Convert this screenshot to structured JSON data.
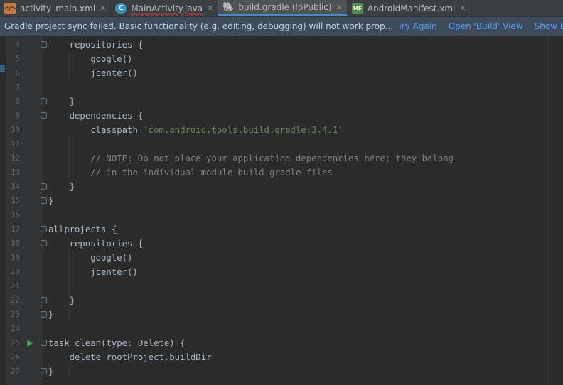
{
  "tabs": [
    {
      "icon": "xml-file-icon",
      "icon_text": "</>",
      "label": "activity_main.xml",
      "active": false,
      "error": false
    },
    {
      "icon": "java-class-icon",
      "icon_text": "C",
      "label": "MainActivity.java",
      "active": false,
      "error": true
    },
    {
      "icon": "gradle-icon",
      "icon_text": "🐘",
      "label": "build.gradle (lpPublic)",
      "active": true,
      "error": false
    },
    {
      "icon": "manifest-icon",
      "icon_text": "MF",
      "label": "AndroidManifest.xml",
      "active": false,
      "error": false
    }
  ],
  "close_glyph": "✕",
  "notification": {
    "message": "Gradle project sync failed. Basic functionality (e.g. editing, debugging) will not work prop...",
    "links": [
      "Try Again",
      "Open 'Build' View",
      "Show Log in Explorer"
    ]
  },
  "colors": {
    "keyword": "#a9b7c6",
    "string": "#6a8759",
    "comment": "#808080",
    "run": "#499c54"
  },
  "lines": [
    {
      "n": "4",
      "text": "    repositories {",
      "kind": "plain"
    },
    {
      "n": "5",
      "text": "        google()",
      "kind": "plain"
    },
    {
      "n": "6",
      "text": "        jcenter()",
      "kind": "plain"
    },
    {
      "n": "7",
      "text": "",
      "kind": "plain"
    },
    {
      "n": "8",
      "text": "    }",
      "kind": "plain"
    },
    {
      "n": "9",
      "text": "    dependencies {",
      "kind": "plain"
    },
    {
      "n": "10",
      "text": "        classpath ",
      "str": "'com.android.tools.build:gradle:3.4.1'",
      "kind": "string"
    },
    {
      "n": "11",
      "text": "",
      "kind": "plain"
    },
    {
      "n": "12",
      "text": "        // NOTE: Do not place your application dependencies here; they belong",
      "kind": "comment"
    },
    {
      "n": "13",
      "text": "        // in the individual module build.gradle files",
      "kind": "comment"
    },
    {
      "n": "14",
      "text": "    }",
      "kind": "plain"
    },
    {
      "n": "15",
      "text": "}",
      "kind": "plain"
    },
    {
      "n": "16",
      "text": "",
      "kind": "plain"
    },
    {
      "n": "17",
      "text": "allprojects {",
      "kind": "plain"
    },
    {
      "n": "18",
      "text": "    repositories {",
      "kind": "plain"
    },
    {
      "n": "19",
      "text": "        google()",
      "kind": "plain"
    },
    {
      "n": "20",
      "text": "        jcenter()",
      "kind": "plain"
    },
    {
      "n": "21",
      "text": "",
      "kind": "plain"
    },
    {
      "n": "22",
      "text": "    }",
      "kind": "plain"
    },
    {
      "n": "23",
      "text": "}",
      "kind": "plain"
    },
    {
      "n": "24",
      "text": "",
      "kind": "plain"
    },
    {
      "n": "25",
      "text": "task clean(type: Delete) {",
      "kind": "plain",
      "run": true
    },
    {
      "n": "26",
      "text": "    delete rootProject.buildDir",
      "kind": "plain"
    },
    {
      "n": "27",
      "text": "}",
      "kind": "plain"
    }
  ],
  "folds": [
    "4",
    "8",
    "9",
    "14",
    "15",
    "17",
    "18",
    "22",
    "23",
    "25",
    "27"
  ]
}
